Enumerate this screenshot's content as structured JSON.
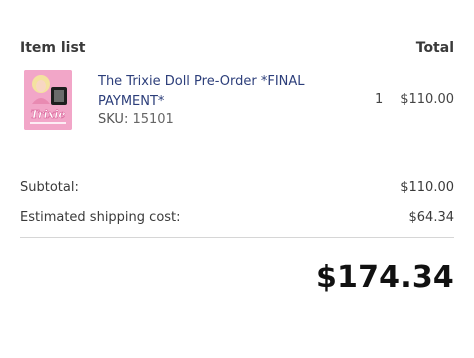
{
  "header": {
    "left_label": "Item list",
    "right_label": "Total"
  },
  "items": [
    {
      "name": "The Trixie Doll Pre-Order *FINAL PAYMENT*",
      "sku_label": "SKU:",
      "sku_value": "15101",
      "quantity": "1",
      "price": "$110.00",
      "thumbnail_logo_text": "Trixie"
    }
  ],
  "summary": {
    "subtotal_label": "Subtotal:",
    "subtotal_value": "$110.00",
    "shipping_label": "Estimated shipping cost:",
    "shipping_value": "$64.34",
    "grand_total": "$174.34"
  },
  "colors": {
    "product_link": "#2c3e7a",
    "thumbnail_bg": "#f2a6c8",
    "divider": "#d6d6d6"
  }
}
